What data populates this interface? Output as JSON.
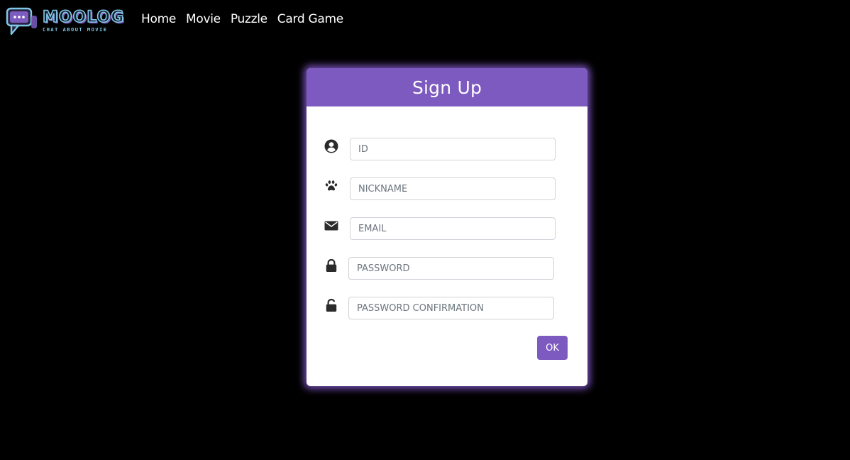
{
  "brand": {
    "name": "MOOLOG",
    "tagline": "CHAT ABOUT MOVIE",
    "colors": {
      "outline": "#7ec8e8",
      "accent": "#7d5cc0"
    }
  },
  "nav": {
    "items": [
      {
        "label": "Home"
      },
      {
        "label": "Movie"
      },
      {
        "label": "Puzzle"
      },
      {
        "label": "Card Game"
      }
    ]
  },
  "form": {
    "title": "Sign Up",
    "fields": [
      {
        "icon": "user-circle-icon",
        "placeholder": "ID",
        "value": ""
      },
      {
        "icon": "paw-icon",
        "placeholder": "NICKNAME",
        "value": ""
      },
      {
        "icon": "envelope-icon",
        "placeholder": "EMAIL",
        "value": ""
      },
      {
        "icon": "lock-icon",
        "placeholder": "PASSWORD",
        "value": ""
      },
      {
        "icon": "unlock-icon",
        "placeholder": "PASSWORD CONFIRMATION",
        "value": ""
      }
    ],
    "submit_label": "OK"
  },
  "colors": {
    "background": "#000000",
    "header": "#7d5abf",
    "button": "#7d5abf",
    "glow": "#9664e6"
  }
}
